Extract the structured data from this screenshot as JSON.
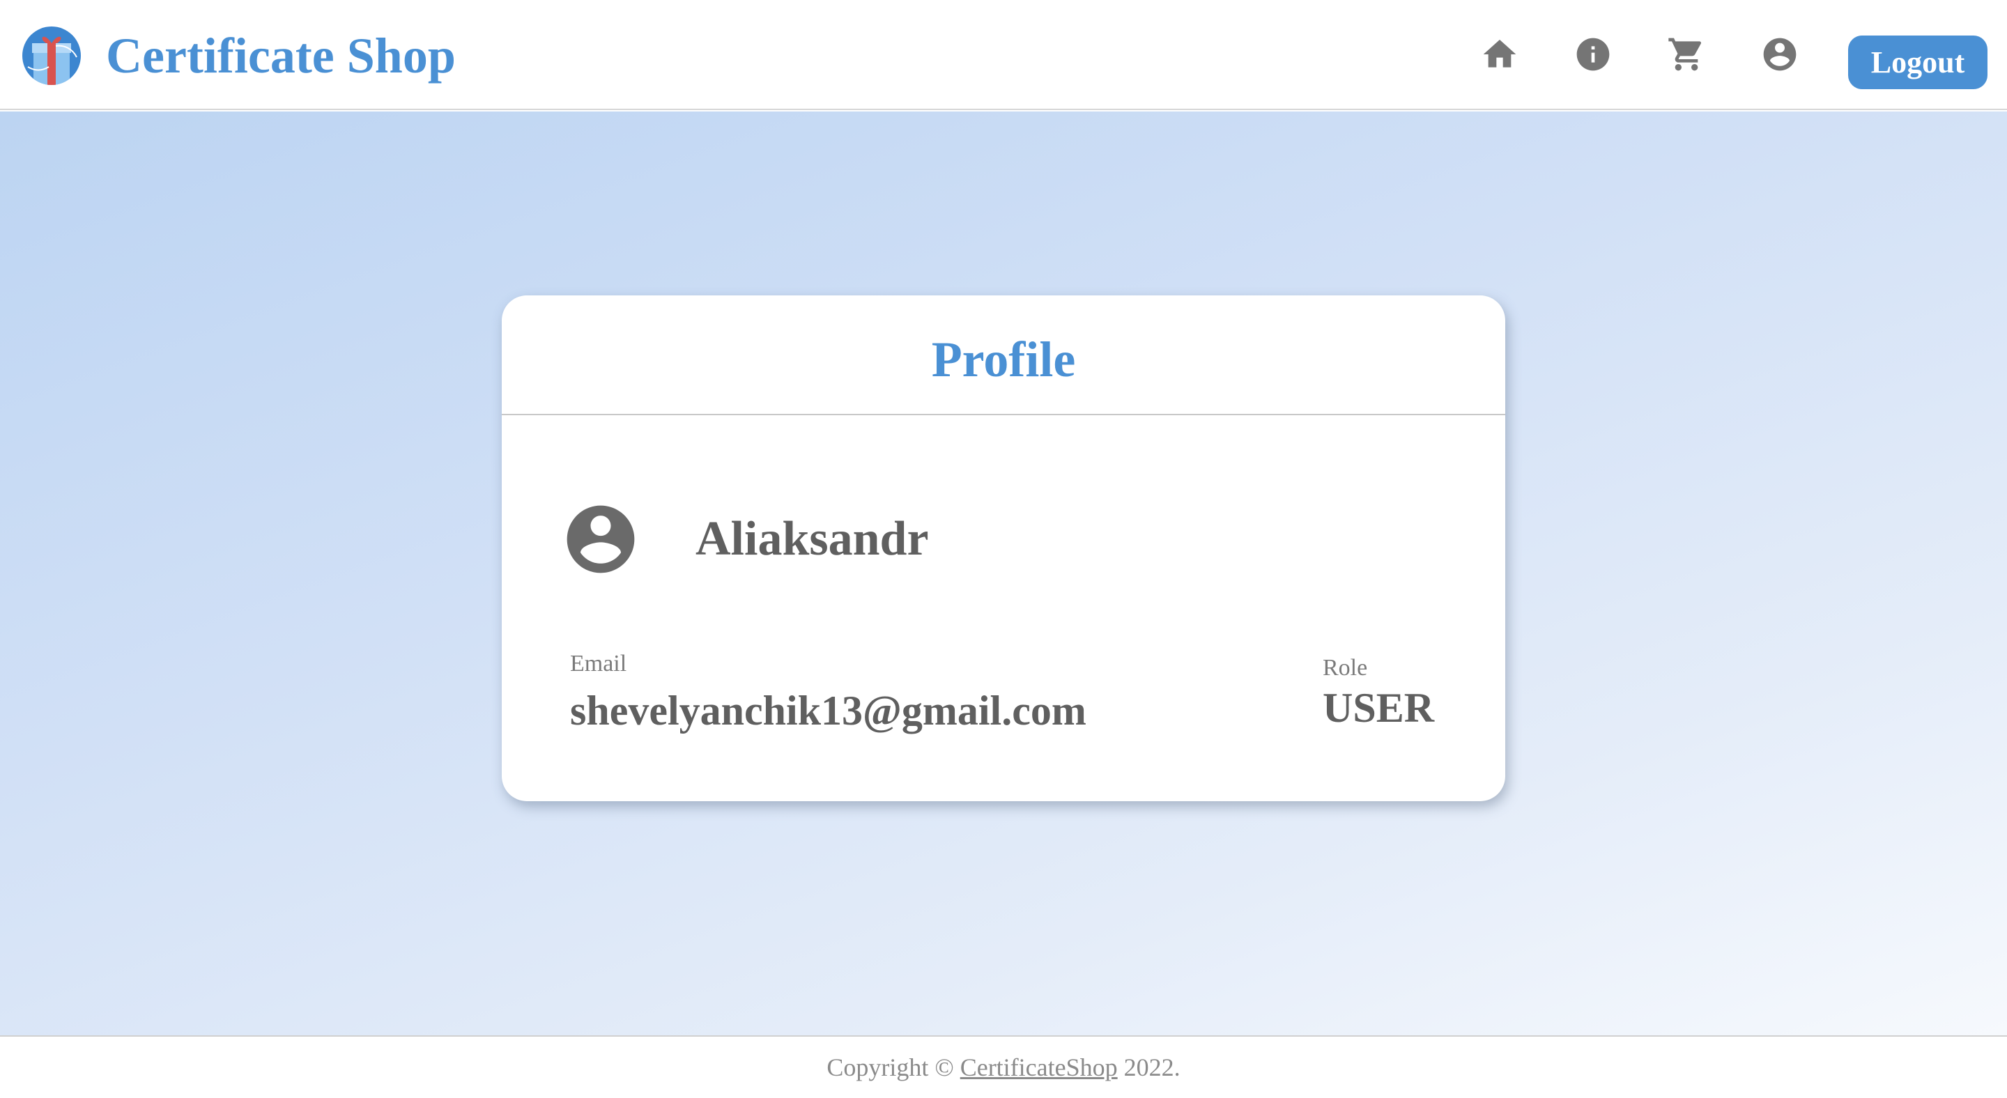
{
  "header": {
    "brand_title": "Certificate Shop",
    "logo_icon": "gift-box-logo",
    "nav": {
      "home_icon": "home-icon",
      "info_icon": "info-icon",
      "cart_icon": "cart-icon",
      "account_icon": "account-circle-icon"
    },
    "logout_label": "Logout"
  },
  "profile": {
    "title": "Profile",
    "avatar_icon": "account-circle-icon",
    "username": "Aliaksandr",
    "email_label": "Email",
    "email_value": "shevelyanchik13@gmail.com",
    "role_label": "Role",
    "role_value": "USER"
  },
  "footer": {
    "copyright_prefix": "Copyright ©",
    "link_text": "CertificateShop",
    "year_suffix": "2022."
  },
  "colors": {
    "accent": "#4a90d4",
    "icon_gray": "#757575",
    "text_gray": "#5f5f5f"
  }
}
